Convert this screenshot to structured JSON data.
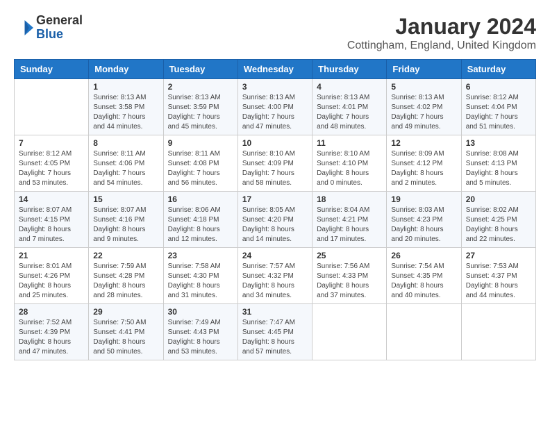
{
  "logo": {
    "general": "General",
    "blue": "Blue"
  },
  "title": "January 2024",
  "location": "Cottingham, England, United Kingdom",
  "days_of_week": [
    "Sunday",
    "Monday",
    "Tuesday",
    "Wednesday",
    "Thursday",
    "Friday",
    "Saturday"
  ],
  "weeks": [
    [
      {
        "day": "",
        "sunrise": "",
        "sunset": "",
        "daylight": ""
      },
      {
        "day": "1",
        "sunrise": "Sunrise: 8:13 AM",
        "sunset": "Sunset: 3:58 PM",
        "daylight": "Daylight: 7 hours and 44 minutes."
      },
      {
        "day": "2",
        "sunrise": "Sunrise: 8:13 AM",
        "sunset": "Sunset: 3:59 PM",
        "daylight": "Daylight: 7 hours and 45 minutes."
      },
      {
        "day": "3",
        "sunrise": "Sunrise: 8:13 AM",
        "sunset": "Sunset: 4:00 PM",
        "daylight": "Daylight: 7 hours and 47 minutes."
      },
      {
        "day": "4",
        "sunrise": "Sunrise: 8:13 AM",
        "sunset": "Sunset: 4:01 PM",
        "daylight": "Daylight: 7 hours and 48 minutes."
      },
      {
        "day": "5",
        "sunrise": "Sunrise: 8:13 AM",
        "sunset": "Sunset: 4:02 PM",
        "daylight": "Daylight: 7 hours and 49 minutes."
      },
      {
        "day": "6",
        "sunrise": "Sunrise: 8:12 AM",
        "sunset": "Sunset: 4:04 PM",
        "daylight": "Daylight: 7 hours and 51 minutes."
      }
    ],
    [
      {
        "day": "7",
        "sunrise": "Sunrise: 8:12 AM",
        "sunset": "Sunset: 4:05 PM",
        "daylight": "Daylight: 7 hours and 53 minutes."
      },
      {
        "day": "8",
        "sunrise": "Sunrise: 8:11 AM",
        "sunset": "Sunset: 4:06 PM",
        "daylight": "Daylight: 7 hours and 54 minutes."
      },
      {
        "day": "9",
        "sunrise": "Sunrise: 8:11 AM",
        "sunset": "Sunset: 4:08 PM",
        "daylight": "Daylight: 7 hours and 56 minutes."
      },
      {
        "day": "10",
        "sunrise": "Sunrise: 8:10 AM",
        "sunset": "Sunset: 4:09 PM",
        "daylight": "Daylight: 7 hours and 58 minutes."
      },
      {
        "day": "11",
        "sunrise": "Sunrise: 8:10 AM",
        "sunset": "Sunset: 4:10 PM",
        "daylight": "Daylight: 8 hours and 0 minutes."
      },
      {
        "day": "12",
        "sunrise": "Sunrise: 8:09 AM",
        "sunset": "Sunset: 4:12 PM",
        "daylight": "Daylight: 8 hours and 2 minutes."
      },
      {
        "day": "13",
        "sunrise": "Sunrise: 8:08 AM",
        "sunset": "Sunset: 4:13 PM",
        "daylight": "Daylight: 8 hours and 5 minutes."
      }
    ],
    [
      {
        "day": "14",
        "sunrise": "Sunrise: 8:07 AM",
        "sunset": "Sunset: 4:15 PM",
        "daylight": "Daylight: 8 hours and 7 minutes."
      },
      {
        "day": "15",
        "sunrise": "Sunrise: 8:07 AM",
        "sunset": "Sunset: 4:16 PM",
        "daylight": "Daylight: 8 hours and 9 minutes."
      },
      {
        "day": "16",
        "sunrise": "Sunrise: 8:06 AM",
        "sunset": "Sunset: 4:18 PM",
        "daylight": "Daylight: 8 hours and 12 minutes."
      },
      {
        "day": "17",
        "sunrise": "Sunrise: 8:05 AM",
        "sunset": "Sunset: 4:20 PM",
        "daylight": "Daylight: 8 hours and 14 minutes."
      },
      {
        "day": "18",
        "sunrise": "Sunrise: 8:04 AM",
        "sunset": "Sunset: 4:21 PM",
        "daylight": "Daylight: 8 hours and 17 minutes."
      },
      {
        "day": "19",
        "sunrise": "Sunrise: 8:03 AM",
        "sunset": "Sunset: 4:23 PM",
        "daylight": "Daylight: 8 hours and 20 minutes."
      },
      {
        "day": "20",
        "sunrise": "Sunrise: 8:02 AM",
        "sunset": "Sunset: 4:25 PM",
        "daylight": "Daylight: 8 hours and 22 minutes."
      }
    ],
    [
      {
        "day": "21",
        "sunrise": "Sunrise: 8:01 AM",
        "sunset": "Sunset: 4:26 PM",
        "daylight": "Daylight: 8 hours and 25 minutes."
      },
      {
        "day": "22",
        "sunrise": "Sunrise: 7:59 AM",
        "sunset": "Sunset: 4:28 PM",
        "daylight": "Daylight: 8 hours and 28 minutes."
      },
      {
        "day": "23",
        "sunrise": "Sunrise: 7:58 AM",
        "sunset": "Sunset: 4:30 PM",
        "daylight": "Daylight: 8 hours and 31 minutes."
      },
      {
        "day": "24",
        "sunrise": "Sunrise: 7:57 AM",
        "sunset": "Sunset: 4:32 PM",
        "daylight": "Daylight: 8 hours and 34 minutes."
      },
      {
        "day": "25",
        "sunrise": "Sunrise: 7:56 AM",
        "sunset": "Sunset: 4:33 PM",
        "daylight": "Daylight: 8 hours and 37 minutes."
      },
      {
        "day": "26",
        "sunrise": "Sunrise: 7:54 AM",
        "sunset": "Sunset: 4:35 PM",
        "daylight": "Daylight: 8 hours and 40 minutes."
      },
      {
        "day": "27",
        "sunrise": "Sunrise: 7:53 AM",
        "sunset": "Sunset: 4:37 PM",
        "daylight": "Daylight: 8 hours and 44 minutes."
      }
    ],
    [
      {
        "day": "28",
        "sunrise": "Sunrise: 7:52 AM",
        "sunset": "Sunset: 4:39 PM",
        "daylight": "Daylight: 8 hours and 47 minutes."
      },
      {
        "day": "29",
        "sunrise": "Sunrise: 7:50 AM",
        "sunset": "Sunset: 4:41 PM",
        "daylight": "Daylight: 8 hours and 50 minutes."
      },
      {
        "day": "30",
        "sunrise": "Sunrise: 7:49 AM",
        "sunset": "Sunset: 4:43 PM",
        "daylight": "Daylight: 8 hours and 53 minutes."
      },
      {
        "day": "31",
        "sunrise": "Sunrise: 7:47 AM",
        "sunset": "Sunset: 4:45 PM",
        "daylight": "Daylight: 8 hours and 57 minutes."
      },
      {
        "day": "",
        "sunrise": "",
        "sunset": "",
        "daylight": ""
      },
      {
        "day": "",
        "sunrise": "",
        "sunset": "",
        "daylight": ""
      },
      {
        "day": "",
        "sunrise": "",
        "sunset": "",
        "daylight": ""
      }
    ]
  ]
}
